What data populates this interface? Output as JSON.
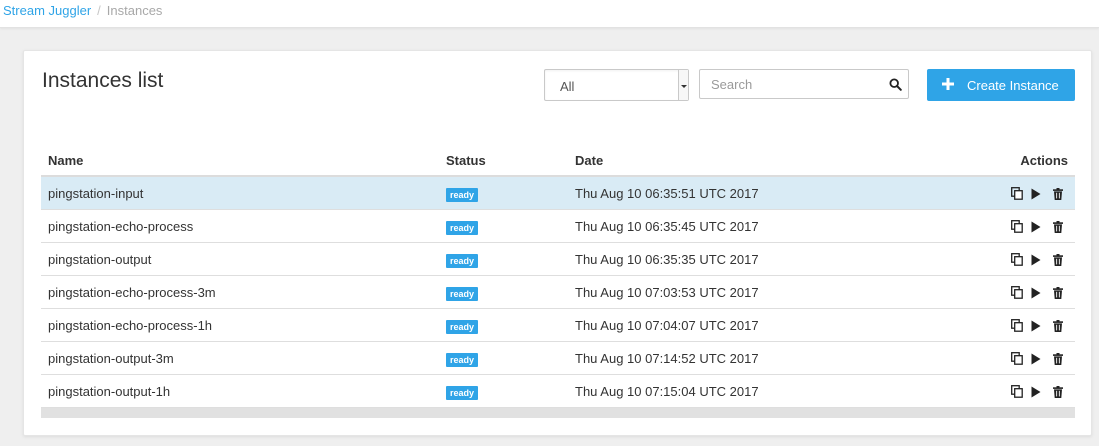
{
  "breadcrumb": {
    "root": "Stream Juggler",
    "separator": "/",
    "current": "Instances"
  },
  "page": {
    "title": "Instances list"
  },
  "filter": {
    "selected": "All"
  },
  "search": {
    "placeholder": "Search",
    "value": ""
  },
  "create_button": {
    "label": "Create Instance"
  },
  "table": {
    "columns": {
      "name": "Name",
      "status": "Status",
      "date": "Date",
      "actions": "Actions"
    },
    "rows": [
      {
        "name": "pingstation-input",
        "status": "ready",
        "date": "Thu Aug 10 06:35:51 UTC 2017"
      },
      {
        "name": "pingstation-echo-process",
        "status": "ready",
        "date": "Thu Aug 10 06:35:45 UTC 2017"
      },
      {
        "name": "pingstation-output",
        "status": "ready",
        "date": "Thu Aug 10 06:35:35 UTC 2017"
      },
      {
        "name": "pingstation-echo-process-3m",
        "status": "ready",
        "date": "Thu Aug 10 07:03:53 UTC 2017"
      },
      {
        "name": "pingstation-echo-process-1h",
        "status": "ready",
        "date": "Thu Aug 10 07:04:07 UTC 2017"
      },
      {
        "name": "pingstation-output-3m",
        "status": "ready",
        "date": "Thu Aug 10 07:14:52 UTC 2017"
      },
      {
        "name": "pingstation-output-1h",
        "status": "ready",
        "date": "Thu Aug 10 07:15:04 UTC 2017"
      }
    ],
    "row_actions": [
      "copy-icon",
      "play-icon",
      "trash-icon"
    ]
  },
  "colors": {
    "accent": "#2fa4e7",
    "selected_row": "#d9ebf5",
    "background": "#efefef"
  }
}
